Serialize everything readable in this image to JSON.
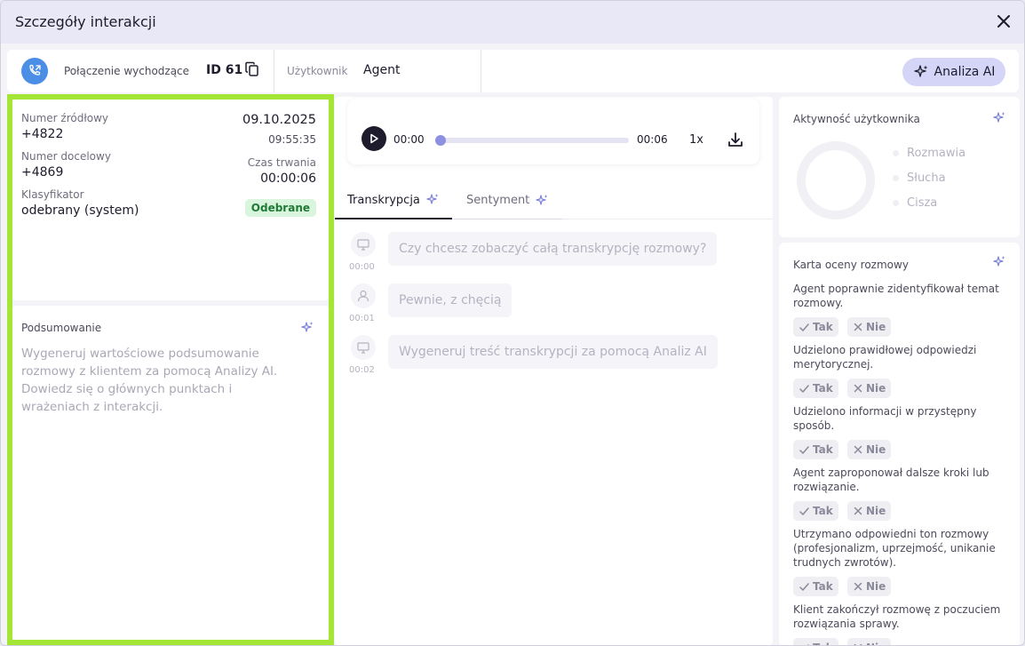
{
  "window": {
    "title": "Szczegóły interakcji"
  },
  "header": {
    "call_type": "Połączenie wychodzące",
    "call_id": "ID 61",
    "user_label": "Użytkownik",
    "user_value": "Agent",
    "ai_button": "Analiza AI"
  },
  "info": {
    "source_label": "Numer źródłowy",
    "source_value": "+4822",
    "target_label": "Numer docelowy",
    "target_value": "+4869",
    "classifier_label": "Klasyfikator",
    "classifier_value": "odebrany (system)",
    "date": "09.10.2025",
    "time": "09:55:35",
    "duration_label": "Czas trwania",
    "duration_value": "00:00:06",
    "status": "Odebrane"
  },
  "summary": {
    "title": "Podsumowanie",
    "text": "Wygeneruj wartościowe podsumowanie rozmowy z klientem za pomocą Analizy AI. Dowiedz się o głównych punktach i wrażeniach z interakcji."
  },
  "player": {
    "current": "00:00",
    "total": "00:06",
    "speed": "1x",
    "progress": 0
  },
  "tabs": [
    {
      "label": "Transkrypcja"
    },
    {
      "label": "Sentyment"
    }
  ],
  "transcript": [
    {
      "speaker_icon": "monitor-icon",
      "time": "00:00",
      "text": "Czy chcesz zobaczyć całą transkrypcję rozmowy?"
    },
    {
      "speaker_icon": "user-icon",
      "time": "00:01",
      "text": "Pewnie, z chęcią"
    },
    {
      "speaker_icon": "monitor-icon",
      "time": "00:02",
      "text": "Wygeneruj treść transkrypcji za pomocą Analiz AI"
    }
  ],
  "activity": {
    "title": "Aktywność użytkownika",
    "legend": [
      "Rozmawia",
      "Słucha",
      "Cisza"
    ]
  },
  "scorecard": {
    "title": "Karta oceny rozmowy",
    "yes_label": "Tak",
    "no_label": "Nie",
    "questions": [
      {
        "line1": "Agent poprawnie zidentyfikował temat",
        "line2": "rozmowy.",
        "line3": ""
      },
      {
        "line1": "Udzielono prawidłowej odpowiedzi",
        "line2": "merytorycznej.",
        "line3": ""
      },
      {
        "line1": "Udzielono informacji w przystępny",
        "line2": "sposób.",
        "line3": ""
      },
      {
        "line1": "Agent zaproponował dalsze kroki lub",
        "line2": "rozwiązanie.",
        "line3": ""
      },
      {
        "line1": "Utrzymano odpowiedni ton rozmowy",
        "line2": "(profesjonalizm, uprzejmość, unikanie",
        "line3": "trudnych zwrotów)."
      },
      {
        "line1": "Klient zakończył rozmowę z poczuciem",
        "line2": "rozwiązania sprawy.",
        "line3": ""
      }
    ]
  },
  "colors": {
    "highlight_border": "#a3e635",
    "accent": "#8d90e0",
    "phone_badge": "#4a8ee6",
    "status_bg": "#d9f5de"
  }
}
